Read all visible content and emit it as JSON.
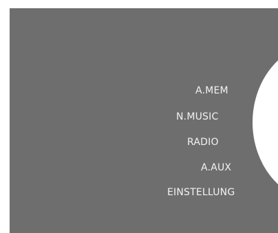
{
  "colors": {
    "panel_background": "#6e6e6e",
    "wheel": "#ffffff",
    "text": "#f2f2f2"
  },
  "menu": {
    "items": [
      {
        "label": "A.MEM"
      },
      {
        "label": "N.MUSIC"
      },
      {
        "label": "RADIO"
      },
      {
        "label": "A.AUX"
      },
      {
        "label": "EINSTELLUNG"
      }
    ]
  }
}
